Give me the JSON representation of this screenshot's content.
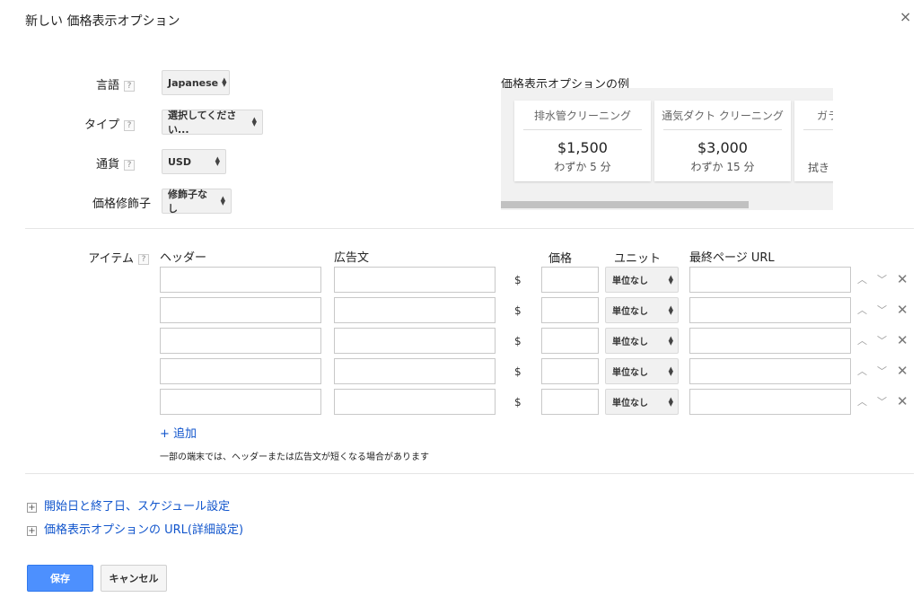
{
  "dialog": {
    "title": "新しい 価格表示オプション",
    "close_glyph": "×"
  },
  "form": {
    "language": {
      "label": "言語",
      "value": "Japanese"
    },
    "type": {
      "label": "タイプ",
      "value": "選択してください..."
    },
    "currency": {
      "label": "通貨",
      "value": "USD"
    },
    "qualifier": {
      "label": "価格修飾子",
      "value": "修飾子なし"
    },
    "help_glyph": "?"
  },
  "preview": {
    "title": "価格表示オプションの例",
    "cards": [
      {
        "header": "排水管クリーニング",
        "price": "$1,500",
        "desc": "わずか 5 分"
      },
      {
        "header": "通気ダクト クリーニング",
        "price": "$3,000",
        "desc": "わずか 15 分"
      },
      {
        "header": "ガラ",
        "price": "",
        "desc": "拭き"
      }
    ]
  },
  "items": {
    "label": "アイテム",
    "columns": {
      "header": "ヘッダー",
      "ad_text": "広告文",
      "price": "価格",
      "unit": "ユニット",
      "final_url": "最終ページ URL"
    },
    "currency_symbol": "$",
    "rows": [
      {
        "unit": "単位なし"
      },
      {
        "unit": "単位なし"
      },
      {
        "unit": "単位なし"
      },
      {
        "unit": "単位なし"
      },
      {
        "unit": "単位なし"
      }
    ],
    "add_label": "+ 追加",
    "note": "一部の端末では、ヘッダーまたは広告文が短くなる場合があります"
  },
  "sections": {
    "schedule": "開始日と終了日、スケジュール設定",
    "url_advanced": "価格表示オプションの URL(詳細設定)",
    "expand_glyph": "+"
  },
  "buttons": {
    "save": "保存",
    "cancel": "キャンセル"
  },
  "colors": {
    "accent": "#4d90fe",
    "link": "#1155cc"
  }
}
